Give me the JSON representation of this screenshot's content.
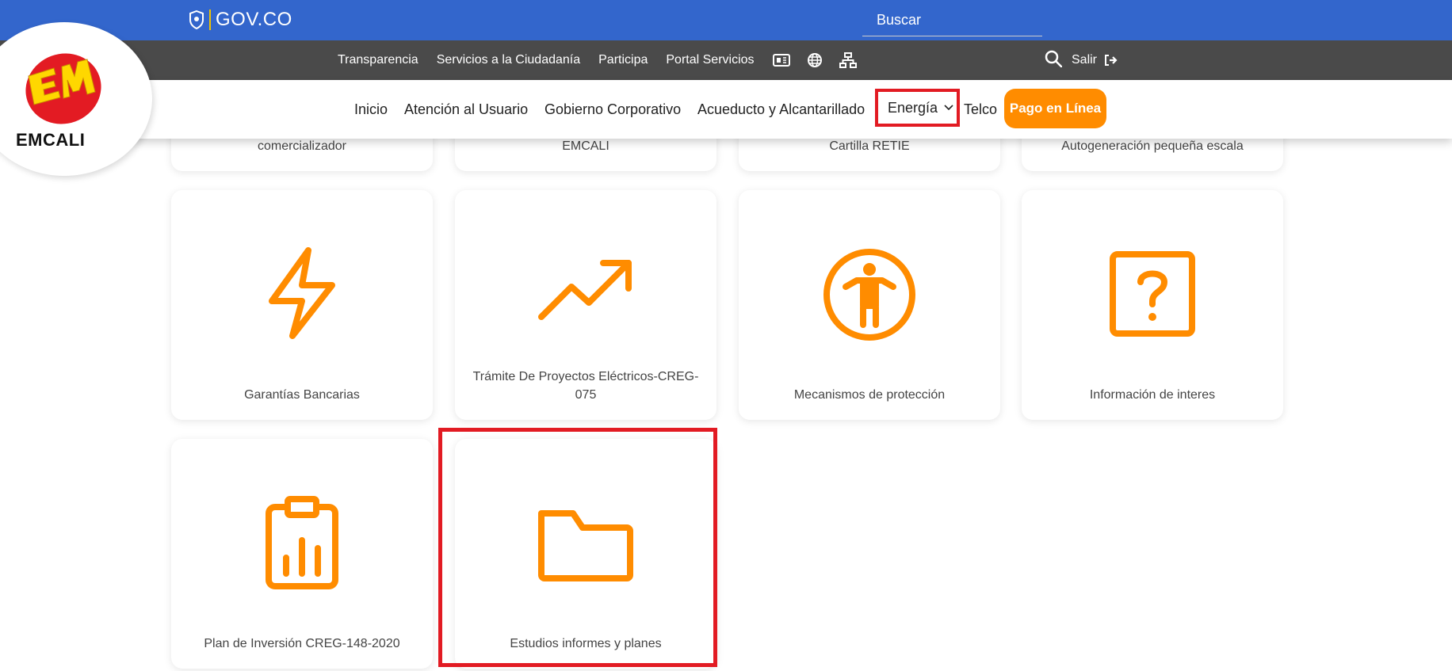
{
  "gov_bar": {
    "logo_text": "GOV.CO"
  },
  "utility_bar": {
    "links": [
      "Transparencia",
      "Servicios a la Ciudadanía",
      "Participa",
      "Portal Servicios"
    ],
    "search_placeholder": "Buscar",
    "logout_label": "Salir"
  },
  "logo": {
    "text": "EMCALI"
  },
  "main_nav": {
    "items": [
      "Inicio",
      "Atención al Usuario",
      "Gobierno Corporativo",
      "Acueducto y Alcantarillado",
      "Energía",
      "Telco"
    ],
    "cta_label": "Pago en Línea"
  },
  "cards_top_row": [
    {
      "label": "comercializador"
    },
    {
      "label": "EMCALI"
    },
    {
      "label": "Cartilla RETIE"
    },
    {
      "label": "Autogeneración pequeña escala"
    }
  ],
  "cards": [
    {
      "label": "Garantías Bancarias",
      "icon": "lightning-icon"
    },
    {
      "label_line1": "Trámite De Proyectos Eléctricos-CREG-",
      "label_line2": "075",
      "icon": "trending-up-icon"
    },
    {
      "label": "Mecanismos de protección",
      "icon": "accessibility-icon"
    },
    {
      "label": "Información de interes",
      "icon": "question-square-icon"
    },
    {
      "label": "Plan de Inversión CREG-148-2020",
      "icon": "clipboard-chart-icon"
    },
    {
      "label": "Estudios informes y planes",
      "icon": "folder-icon"
    }
  ],
  "colors": {
    "gov_blue": "#3366cc",
    "utility_gray": "#4a4a4a",
    "accent_orange": "#ff8c00",
    "highlight_red": "#e21b23"
  }
}
